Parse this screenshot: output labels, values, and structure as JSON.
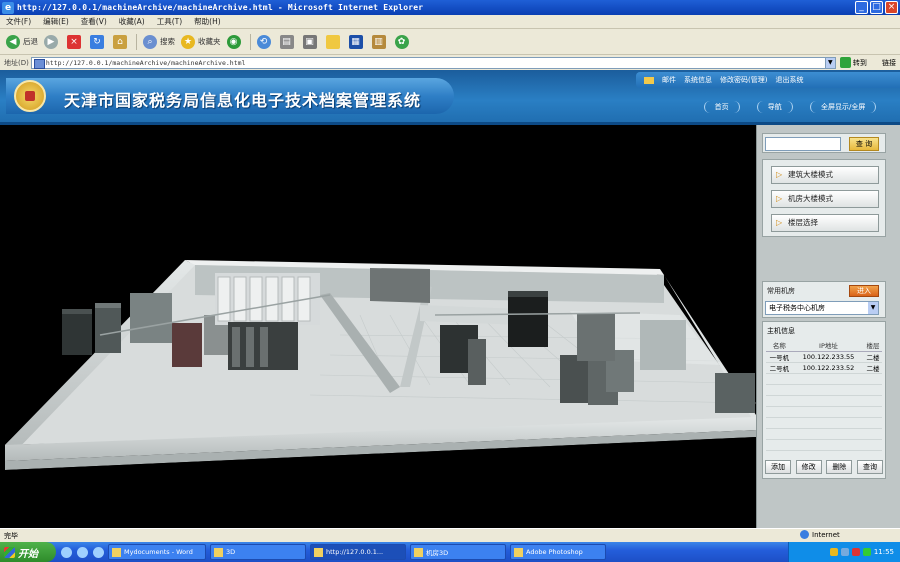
{
  "browser": {
    "title": "http://127.0.0.1/machineArchive/machineArchive.html - Microsoft Internet Explorer",
    "menu": [
      "文件(F)",
      "编辑(E)",
      "查看(V)",
      "收藏(A)",
      "工具(T)",
      "帮助(H)"
    ],
    "toolbar": {
      "back": "后退",
      "search": "搜索",
      "favorites": "收藏夹"
    },
    "address_label": "地址(D)",
    "address": "http://127.0.0.1/machineArchive/machineArchive.html",
    "go": "转到",
    "links": "链接"
  },
  "app": {
    "system_name": "天津市国家税务局信息化电子技术档案管理系统",
    "topnav": [
      "邮件",
      "系统信息",
      "修改密码(管理)",
      "退出系统"
    ],
    "subnav": [
      "首页",
      "导航",
      "全屏显示/全屏"
    ]
  },
  "panel": {
    "search_button": "查 询",
    "modes": [
      "建筑大楼模式",
      "机房大楼模式",
      "楼层选择"
    ],
    "common_label": "常用机房",
    "common_button": "进入",
    "common_selected": "电子税务中心机房",
    "machines_label": "主机信息",
    "machine_columns": [
      "名称",
      "IP地址",
      "楼层"
    ],
    "machine_rows": [
      {
        "name": "一号机",
        "ip": "100.122.233.55",
        "floor": "二楼"
      },
      {
        "name": "二号机",
        "ip": "100.122.233.52",
        "floor": "二楼"
      }
    ],
    "machine_buttons": [
      "添加",
      "修改",
      "删除",
      "查询"
    ]
  },
  "statusbar": {
    "left": "完毕",
    "zone": "Internet"
  },
  "taskbar": {
    "start": "开始",
    "tasks": [
      "Mydocuments - Word",
      "3D",
      "http://127.0.0.1...",
      "机房3D",
      "Adobe Photoshop"
    ],
    "clock": "11:55"
  },
  "colors": {
    "app_header": "#2a7fc4",
    "viewer_bg": "#000000",
    "panel_bg": "#bfc6c6"
  }
}
